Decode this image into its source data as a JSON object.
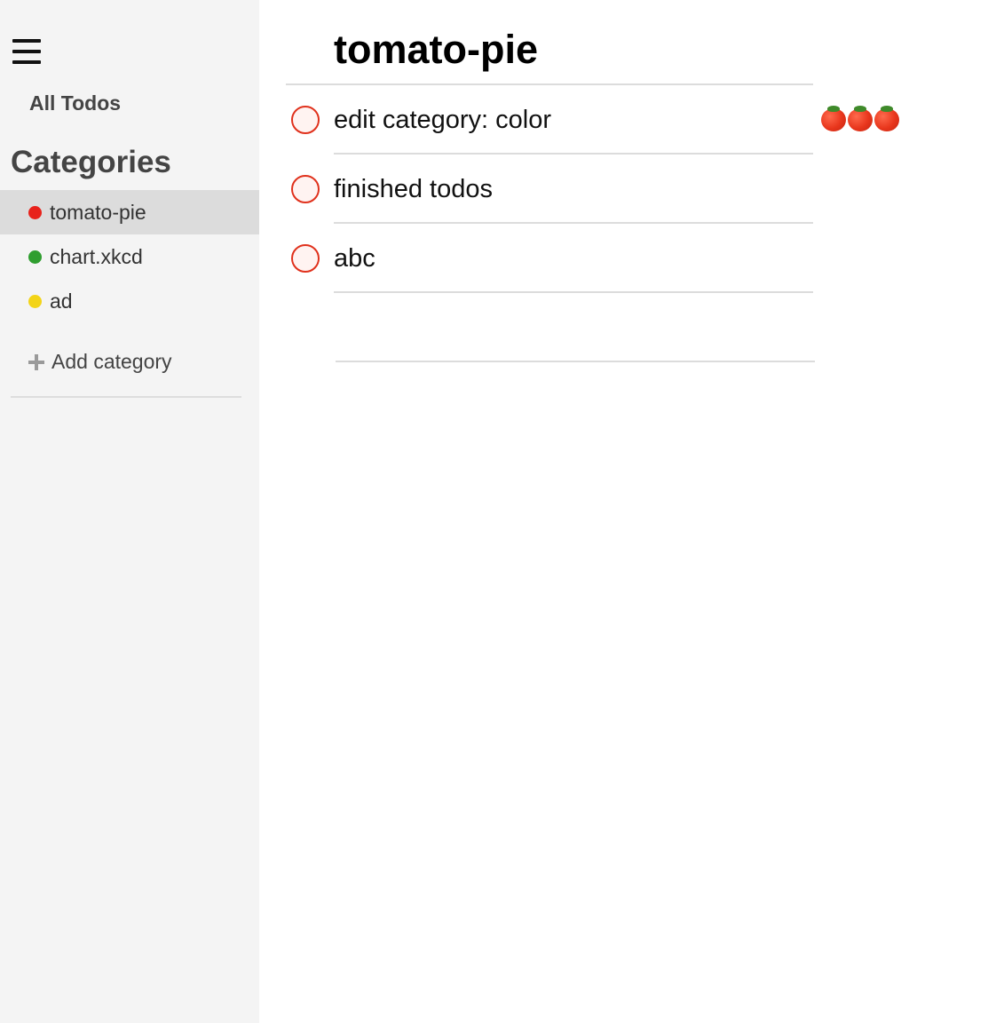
{
  "sidebar": {
    "all_todos_label": "All Todos",
    "categories_heading": "Categories",
    "categories": [
      {
        "label": "tomato-pie",
        "color": "#e8221b",
        "active": true
      },
      {
        "label": "chart.xkcd",
        "color": "#2f9e2f",
        "active": false
      },
      {
        "label": "ad",
        "color": "#f3d417",
        "active": false
      }
    ],
    "add_category_label": "Add category"
  },
  "main": {
    "title": "tomato-pie",
    "todos": [
      {
        "text": "edit category: color",
        "pomodoros": 3
      },
      {
        "text": "finished todos",
        "pomodoros": 0
      },
      {
        "text": "abc",
        "pomodoros": 0
      }
    ],
    "new_todo_placeholder": ""
  },
  "colors": {
    "accent": "#e0311c",
    "sidebar_bg": "#f4f4f4",
    "active_bg": "#dcdcdc"
  }
}
